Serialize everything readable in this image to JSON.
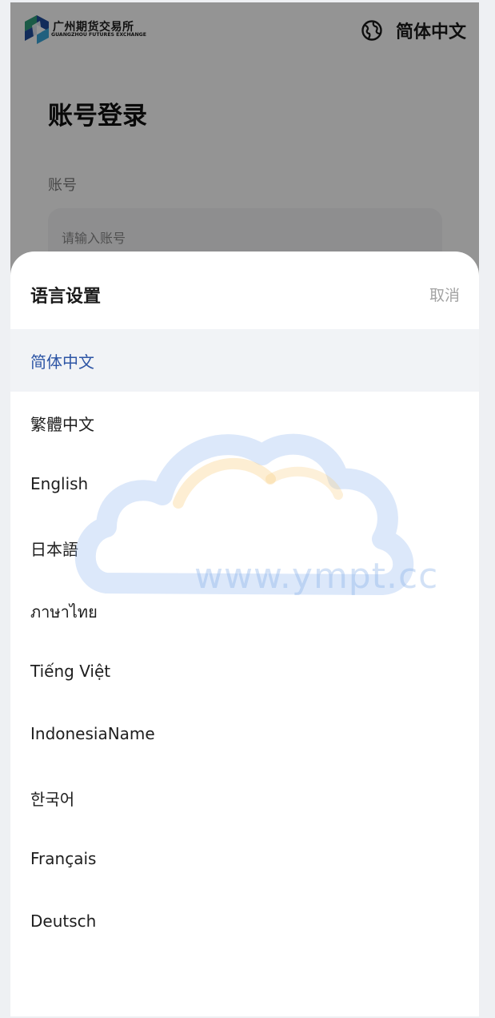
{
  "header": {
    "logo_cn": "广州期货交易所",
    "logo_en": "GUANGZHOU FUTURES EXCHANGE",
    "current_language": "简体中文",
    "globe_icon": "globe-icon"
  },
  "login": {
    "title": "账号登录",
    "account_label": "账号",
    "account_placeholder": "请输入账号"
  },
  "language_sheet": {
    "title": "语言设置",
    "cancel_label": "取消",
    "selected_index": 0,
    "options": [
      "简体中文",
      "繁體中文",
      "English",
      "日本語",
      "ภาษาไทย",
      "Tiếng Việt",
      "IndonesiaName",
      "한국어",
      "Français",
      "Deutsch"
    ]
  },
  "watermark": {
    "text": "www.ympt.cc"
  },
  "colors": {
    "selected_text": "#2d55a5",
    "selected_bg": "#f1f3f6",
    "overlay": "rgba(0,0,0,0.42)"
  }
}
